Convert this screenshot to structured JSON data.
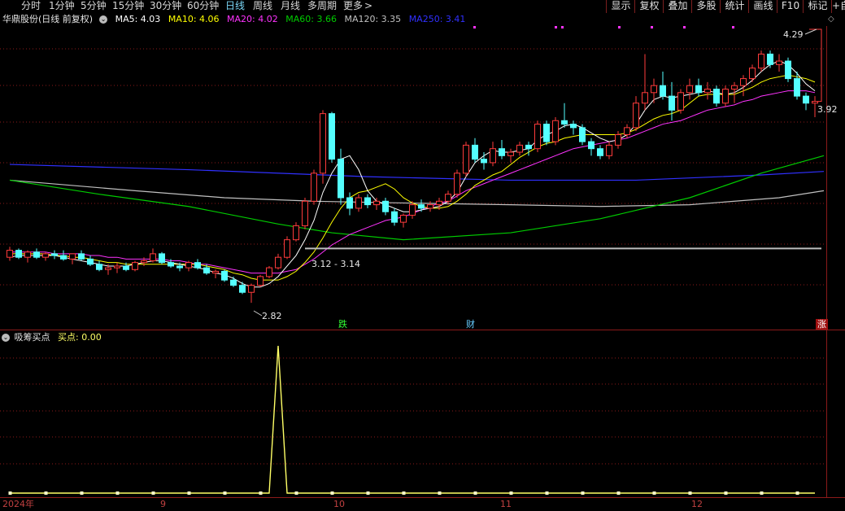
{
  "toolbar": {
    "periods": [
      "分时",
      "1分钟",
      "5分钟",
      "15分钟",
      "30分钟",
      "60分钟",
      "日线",
      "周线",
      "月线",
      "多周期",
      "更多"
    ],
    "active_period": "日线",
    "more_arrow": ">",
    "buttons": [
      "显示",
      "复权",
      "叠加",
      "多股",
      "统计",
      "画线",
      "F10",
      "标记",
      "+自"
    ]
  },
  "legend": {
    "stock": "华鼎股份(日线 前复权)",
    "ma5": "MA5: 4.03",
    "ma10": "MA10: 4.06",
    "ma20": "MA20: 4.02",
    "ma60": "MA60: 3.66",
    "ma120": "MA120: 3.35",
    "ma250": "MA250: 3.41"
  },
  "colors": {
    "up": "#ff3b3b",
    "down": "#54ffff",
    "ma5": "#ffffff",
    "ma10": "#ffff00",
    "ma20": "#ff33ff",
    "ma60": "#00cc00",
    "ma120": "#c0c0c0",
    "ma250": "#3030ff",
    "grid": "#8b1a1a",
    "signal": "#ffff66"
  },
  "annotations": {
    "high": "4.29",
    "low": "2.82",
    "last": "3.92",
    "range": "3.12 - 3.14"
  },
  "signals": {
    "drop": "跌",
    "finance": "财",
    "rise": "涨"
  },
  "indicator": {
    "name": "吸筹买点",
    "value": "买点: 0.00"
  },
  "xaxis": {
    "labels": [
      "2024年",
      "9",
      "10",
      "11",
      "12"
    ]
  },
  "chart_data": {
    "type": "candlestick",
    "ylim": [
      2.7,
      4.4
    ],
    "candles": [
      [
        3.08,
        3.14,
        3.06,
        3.12
      ],
      [
        3.12,
        3.13,
        3.07,
        3.08
      ],
      [
        3.08,
        3.12,
        3.05,
        3.11
      ],
      [
        3.11,
        3.13,
        3.07,
        3.08
      ],
      [
        3.08,
        3.11,
        3.06,
        3.1
      ],
      [
        3.1,
        3.12,
        3.07,
        3.09
      ],
      [
        3.09,
        3.12,
        3.06,
        3.07
      ],
      [
        3.07,
        3.1,
        3.04,
        3.1
      ],
      [
        3.1,
        3.12,
        3.06,
        3.07
      ],
      [
        3.07,
        3.09,
        3.03,
        3.04
      ],
      [
        3.04,
        3.06,
        3.0,
        3.01
      ],
      [
        3.01,
        3.04,
        2.98,
        3.02
      ],
      [
        3.02,
        3.05,
        2.99,
        3.03
      ],
      [
        3.03,
        3.05,
        3.0,
        3.01
      ],
      [
        3.01,
        3.06,
        3.0,
        3.05
      ],
      [
        3.05,
        3.08,
        3.03,
        3.06
      ],
      [
        3.06,
        3.13,
        3.05,
        3.1
      ],
      [
        3.1,
        3.11,
        3.04,
        3.05
      ],
      [
        3.05,
        3.07,
        3.02,
        3.03
      ],
      [
        3.03,
        3.05,
        3.0,
        3.02
      ],
      [
        3.02,
        3.06,
        3.0,
        3.05
      ],
      [
        3.05,
        3.07,
        3.01,
        3.02
      ],
      [
        3.02,
        3.04,
        2.98,
        2.99
      ],
      [
        2.99,
        3.01,
        2.96,
        3.0
      ],
      [
        3.0,
        3.01,
        2.94,
        2.95
      ],
      [
        2.95,
        2.97,
        2.91,
        2.92
      ],
      [
        2.92,
        2.94,
        2.87,
        2.88
      ],
      [
        2.88,
        2.93,
        2.82,
        2.92
      ],
      [
        2.92,
        2.98,
        2.91,
        2.97
      ],
      [
        2.97,
        3.03,
        2.96,
        3.02
      ],
      [
        3.02,
        3.1,
        3.01,
        3.08
      ],
      [
        3.08,
        3.2,
        3.07,
        3.18
      ],
      [
        3.18,
        3.28,
        3.17,
        3.26
      ],
      [
        3.26,
        3.42,
        3.24,
        3.4
      ],
      [
        3.4,
        3.58,
        3.38,
        3.56
      ],
      [
        3.56,
        3.92,
        3.5,
        3.9
      ],
      [
        3.9,
        3.91,
        3.62,
        3.64
      ],
      [
        3.64,
        3.7,
        3.38,
        3.42
      ],
      [
        3.42,
        3.45,
        3.32,
        3.36
      ],
      [
        3.36,
        3.44,
        3.34,
        3.42
      ],
      [
        3.42,
        3.44,
        3.36,
        3.38
      ],
      [
        3.38,
        3.42,
        3.35,
        3.4
      ],
      [
        3.4,
        3.42,
        3.32,
        3.34
      ],
      [
        3.34,
        3.36,
        3.26,
        3.28
      ],
      [
        3.28,
        3.33,
        3.25,
        3.32
      ],
      [
        3.32,
        3.4,
        3.3,
        3.38
      ],
      [
        3.38,
        3.41,
        3.34,
        3.36
      ],
      [
        3.36,
        3.4,
        3.34,
        3.38
      ],
      [
        3.38,
        3.42,
        3.35,
        3.4
      ],
      [
        3.4,
        3.46,
        3.38,
        3.44
      ],
      [
        3.44,
        3.58,
        3.42,
        3.56
      ],
      [
        3.56,
        3.74,
        3.54,
        3.72
      ],
      [
        3.72,
        3.76,
        3.62,
        3.64
      ],
      [
        3.64,
        3.68,
        3.58,
        3.62
      ],
      [
        3.62,
        3.74,
        3.6,
        3.7
      ],
      [
        3.7,
        3.75,
        3.64,
        3.66
      ],
      [
        3.66,
        3.7,
        3.62,
        3.68
      ],
      [
        3.68,
        3.74,
        3.66,
        3.72
      ],
      [
        3.72,
        3.74,
        3.66,
        3.7
      ],
      [
        3.7,
        3.86,
        3.68,
        3.84
      ],
      [
        3.84,
        3.86,
        3.72,
        3.74
      ],
      [
        3.74,
        3.88,
        3.72,
        3.86
      ],
      [
        3.86,
        3.96,
        3.82,
        3.84
      ],
      [
        3.84,
        3.86,
        3.78,
        3.82
      ],
      [
        3.82,
        3.84,
        3.72,
        3.74
      ],
      [
        3.74,
        3.76,
        3.66,
        3.7
      ],
      [
        3.7,
        3.72,
        3.64,
        3.66
      ],
      [
        3.66,
        3.74,
        3.64,
        3.72
      ],
      [
        3.72,
        3.8,
        3.7,
        3.78
      ],
      [
        3.78,
        3.84,
        3.76,
        3.82
      ],
      [
        3.82,
        4.0,
        3.8,
        3.96
      ],
      [
        3.96,
        4.24,
        3.92,
        4.02
      ],
      [
        4.02,
        4.1,
        3.96,
        4.06
      ],
      [
        4.06,
        4.14,
        3.98,
        4.0
      ],
      [
        4.0,
        4.08,
        3.86,
        3.92
      ],
      [
        3.92,
        4.04,
        3.9,
        4.02
      ],
      [
        4.02,
        4.1,
        3.98,
        4.06
      ],
      [
        4.06,
        4.1,
        4.0,
        4.02
      ],
      [
        4.02,
        4.08,
        3.98,
        4.04
      ],
      [
        4.04,
        4.06,
        3.94,
        3.96
      ],
      [
        3.96,
        4.06,
        3.94,
        4.04
      ],
      [
        4.04,
        4.08,
        3.96,
        4.06
      ],
      [
        4.06,
        4.12,
        4.0,
        4.1
      ],
      [
        4.1,
        4.18,
        4.08,
        4.16
      ],
      [
        4.16,
        4.26,
        4.14,
        4.24
      ],
      [
        4.24,
        4.26,
        4.16,
        4.18
      ],
      [
        4.18,
        4.24,
        4.14,
        4.2
      ],
      [
        4.2,
        4.22,
        4.08,
        4.1
      ],
      [
        4.1,
        4.14,
        3.98,
        4.0
      ],
      [
        4.0,
        4.02,
        3.92,
        3.96
      ],
      [
        3.96,
        4.0,
        3.88,
        3.97
      ]
    ],
    "ma": {
      "ma5": [
        3.08,
        3.09,
        3.09,
        3.09,
        3.09,
        3.09,
        3.08,
        3.07,
        3.06,
        3.05,
        3.04,
        3.03,
        3.03,
        3.03,
        3.04,
        3.05,
        3.06,
        3.06,
        3.05,
        3.04,
        3.03,
        3.02,
        3.01,
        2.99,
        2.98,
        2.96,
        2.93,
        2.91,
        2.91,
        2.93,
        2.97,
        3.03,
        3.09,
        3.18,
        3.29,
        3.45,
        3.56,
        3.64,
        3.66,
        3.58,
        3.46,
        3.4,
        3.38,
        3.36,
        3.34,
        3.34,
        3.35,
        3.36,
        3.37,
        3.4,
        3.45,
        3.54,
        3.62,
        3.66,
        3.69,
        3.68,
        3.68,
        3.69,
        3.7,
        3.75,
        3.78,
        3.8,
        3.83,
        3.84,
        3.82,
        3.79,
        3.76,
        3.74,
        3.75,
        3.78,
        3.84,
        3.92,
        3.98,
        4.0,
        3.99,
        4.0,
        4.01,
        4.02,
        4.03,
        4.02,
        4.01,
        4.02,
        4.05,
        4.09,
        4.14,
        4.18,
        4.2,
        4.18,
        4.13,
        4.07,
        4.03
      ],
      "ma10": [
        3.1,
        3.1,
        3.1,
        3.1,
        3.1,
        3.09,
        3.09,
        3.08,
        3.08,
        3.07,
        3.06,
        3.05,
        3.05,
        3.04,
        3.04,
        3.04,
        3.04,
        3.04,
        3.04,
        3.04,
        3.04,
        3.04,
        3.03,
        3.02,
        3.01,
        2.99,
        2.98,
        2.96,
        2.95,
        2.95,
        2.95,
        2.97,
        3.0,
        3.05,
        3.11,
        3.19,
        3.28,
        3.36,
        3.42,
        3.45,
        3.46,
        3.48,
        3.5,
        3.47,
        3.42,
        3.39,
        3.37,
        3.36,
        3.36,
        3.37,
        3.4,
        3.44,
        3.49,
        3.52,
        3.55,
        3.57,
        3.61,
        3.65,
        3.68,
        3.71,
        3.73,
        3.74,
        3.76,
        3.77,
        3.78,
        3.78,
        3.78,
        3.78,
        3.78,
        3.79,
        3.81,
        3.84,
        3.87,
        3.89,
        3.9,
        3.92,
        3.96,
        4.0,
        4.01,
        4.01,
        4.01,
        4.01,
        4.03,
        4.05,
        4.08,
        4.1,
        4.11,
        4.12,
        4.11,
        4.1,
        4.08
      ],
      "ma20": [
        3.11,
        3.11,
        3.11,
        3.11,
        3.11,
        3.1,
        3.1,
        3.1,
        3.1,
        3.09,
        3.09,
        3.08,
        3.08,
        3.07,
        3.07,
        3.07,
        3.07,
        3.07,
        3.06,
        3.06,
        3.05,
        3.04,
        3.04,
        3.03,
        3.02,
        3.01,
        3.0,
        2.99,
        2.99,
        2.99,
        2.99,
        3.0,
        3.01,
        3.04,
        3.07,
        3.11,
        3.15,
        3.18,
        3.21,
        3.23,
        3.25,
        3.27,
        3.29,
        3.3,
        3.31,
        3.33,
        3.35,
        3.37,
        3.39,
        3.4,
        3.43,
        3.46,
        3.48,
        3.5,
        3.52,
        3.54,
        3.56,
        3.58,
        3.6,
        3.62,
        3.64,
        3.66,
        3.68,
        3.7,
        3.71,
        3.72,
        3.73,
        3.74,
        3.75,
        3.76,
        3.78,
        3.8,
        3.82,
        3.84,
        3.85,
        3.86,
        3.88,
        3.9,
        3.92,
        3.93,
        3.94,
        3.95,
        3.97,
        3.98,
        4.0,
        4.01,
        4.02,
        4.03,
        4.03,
        4.03,
        4.02
      ]
    },
    "ma60_path": [
      [
        0,
        3.52
      ],
      [
        10,
        3.44
      ],
      [
        20,
        3.37
      ],
      [
        30,
        3.27
      ],
      [
        36,
        3.22
      ],
      [
        44,
        3.18
      ],
      [
        56,
        3.22
      ],
      [
        66,
        3.3
      ],
      [
        76,
        3.42
      ],
      [
        84,
        3.56
      ],
      [
        91,
        3.66
      ]
    ],
    "ma120_path": [
      [
        0,
        3.52
      ],
      [
        14,
        3.46
      ],
      [
        24,
        3.42
      ],
      [
        34,
        3.4
      ],
      [
        44,
        3.39
      ],
      [
        56,
        3.38
      ],
      [
        66,
        3.37
      ],
      [
        76,
        3.38
      ],
      [
        86,
        3.42
      ],
      [
        91,
        3.46
      ]
    ],
    "ma250_path": [
      [
        0,
        3.61
      ],
      [
        20,
        3.58
      ],
      [
        40,
        3.54
      ],
      [
        56,
        3.52
      ],
      [
        70,
        3.52
      ],
      [
        84,
        3.55
      ],
      [
        91,
        3.57
      ]
    ],
    "indicator": {
      "ylim": [
        0,
        1
      ],
      "spike_index": 30,
      "baseline": 0
    }
  }
}
